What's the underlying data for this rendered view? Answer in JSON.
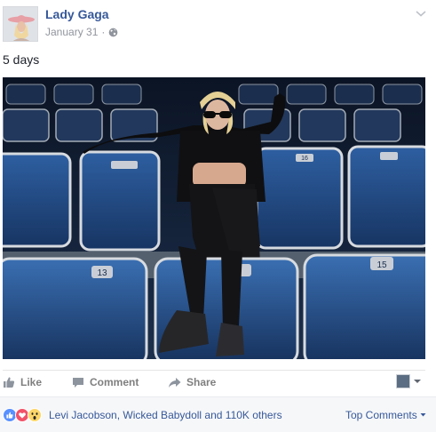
{
  "header": {
    "author": "Lady Gaga",
    "date": "January 31",
    "separator": "·",
    "privacy_icon": "globe-icon",
    "options_icon": "chevron-down-icon"
  },
  "post": {
    "text": "5 days",
    "photo_seat_numbers": [
      "13",
      "15",
      "16"
    ]
  },
  "actions": {
    "like": "Like",
    "comment": "Comment",
    "share": "Share"
  },
  "reactions": {
    "icons": [
      "like-reaction-icon",
      "love-reaction-icon",
      "wow-reaction-icon"
    ],
    "summary": "Levi Jacobson, Wicked Babydoll and 110K others",
    "sort_label": "Top Comments"
  },
  "colors": {
    "link": "#365899",
    "muted": "#90949c",
    "action": "#7f7f7f",
    "like_blue": "#5890ff",
    "love_red": "#f25268",
    "wow_yellow": "#fcd669"
  }
}
